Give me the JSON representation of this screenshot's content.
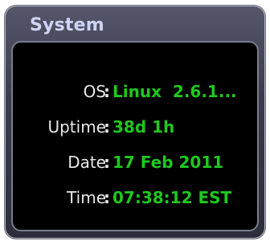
{
  "widget": {
    "title": "System",
    "rows": [
      {
        "label": "OS",
        "value": "Linux  2.6.1..."
      },
      {
        "label": "Uptime",
        "value": "38d 1h"
      },
      {
        "label": "Date",
        "value": "17 Feb 2011"
      },
      {
        "label": "Time",
        "value": "07:38:12 EST"
      }
    ],
    "separator": ":"
  },
  "colors": {
    "value_text": "#1ec81e",
    "label_text": "#e8e8e8",
    "title_text": "#cfd4f4",
    "panel_background": "#000000",
    "frame": "#3a3b4c"
  }
}
